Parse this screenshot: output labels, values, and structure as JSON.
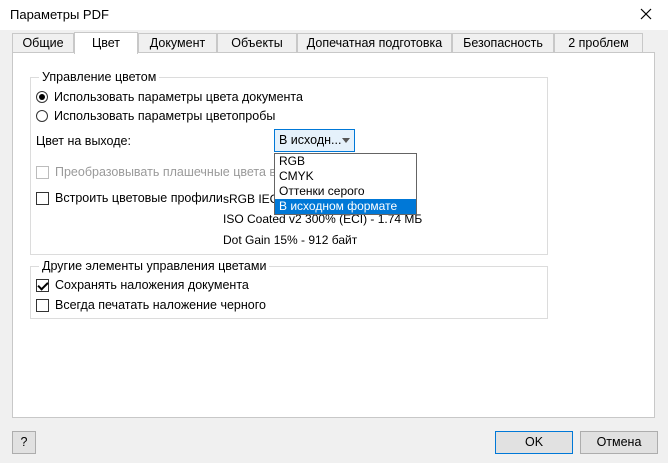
{
  "window": {
    "title": "Параметры PDF"
  },
  "tabs": [
    {
      "label": "Общие"
    },
    {
      "label": "Цвет"
    },
    {
      "label": "Документ"
    },
    {
      "label": "Объекты"
    },
    {
      "label": "Допечатная подготовка"
    },
    {
      "label": "Безопасность"
    },
    {
      "label": "2 проблем"
    }
  ],
  "active_tab": "Цвет",
  "color_management": {
    "title": "Управление цветом",
    "options": [
      {
        "label": "Использовать параметры цвета документа",
        "selected": true
      },
      {
        "label": "Использовать параметры цветопробы",
        "selected": false
      }
    ],
    "output_label": "Цвет на выходе:",
    "output_value": "В исходн...",
    "output_options": [
      "RGB",
      "CMYK",
      "Оттенки серого",
      "В исходном формате"
    ],
    "output_highlighted": "В исходном формате",
    "convert_spot_label": "Преобразовывать плашечные цвета в",
    "convert_spot_checked": false,
    "embed_profiles_label": "Встроить цветовые профили",
    "embed_profiles_checked": false,
    "profiles": [
      "sRGB IEC6",
      "ISO Coated v2 300% (ECI) - 1.74 МБ",
      "Dot Gain 15% - 912 байт"
    ]
  },
  "other_controls": {
    "title": "Другие элементы управления цветами",
    "preserve_overprint_label": "Сохранять наложения документа",
    "preserve_overprint_checked": true,
    "always_overprint_black_label": "Всегда печатать наложение черного",
    "always_overprint_black_checked": false
  },
  "buttons": {
    "help": "?",
    "ok": "OK",
    "cancel": "Отмена"
  },
  "colors": {
    "accent": "#0078d7",
    "selection_bg": "#0078d7",
    "disabled_text": "#9a9a9a"
  }
}
